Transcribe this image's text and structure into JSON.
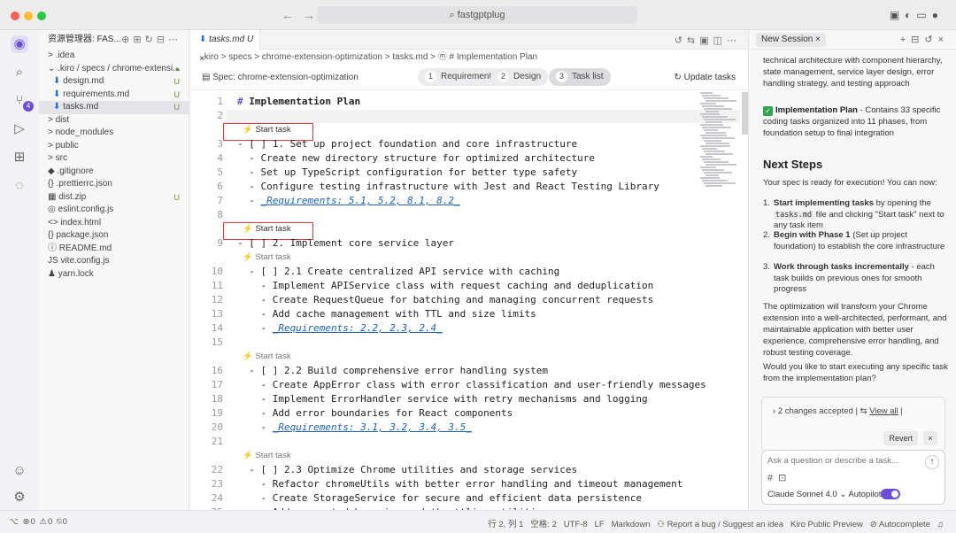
{
  "window": {
    "title": "fastgptplug"
  },
  "explorer": {
    "title": "资源管理器: FAS...",
    "items": [
      {
        "label": "> .idea",
        "indent": 0
      },
      {
        "label": "⌄ .kiro / specs / chrome-extensi...",
        "indent": 0,
        "status": "●"
      },
      {
        "label": "design.md",
        "indent": 1,
        "status": "U",
        "md": true
      },
      {
        "label": "requirements.md",
        "indent": 1,
        "status": "U",
        "md": true
      },
      {
        "label": "tasks.md",
        "indent": 1,
        "status": "U",
        "md": true,
        "selected": true
      },
      {
        "label": "> dist",
        "indent": 0
      },
      {
        "label": "> node_modules",
        "indent": 0
      },
      {
        "label": "> public",
        "indent": 0
      },
      {
        "label": "> src",
        "indent": 0
      },
      {
        "label": "◆ .gitignore",
        "indent": 0
      },
      {
        "label": "{} .prettierrc.json",
        "indent": 0
      },
      {
        "label": "▦ dist.zip",
        "indent": 0,
        "status": "U"
      },
      {
        "label": "◎ eslint.config.js",
        "indent": 0
      },
      {
        "label": "<> index.html",
        "indent": 0
      },
      {
        "label": "{} package.json",
        "indent": 0
      },
      {
        "label": "ⓘ README.md",
        "indent": 0
      },
      {
        "label": "JS vite.config.js",
        "indent": 0
      },
      {
        "label": "♟ yarn.lock",
        "indent": 0
      }
    ]
  },
  "editor": {
    "tab": "tasks.md U",
    "breadcrumb": ".kiro > specs > chrome-extension-optimization > tasks.md > ⓜ # Implementation Plan",
    "spec_label": "Spec: chrome-extension-optimization",
    "spec_tabs": [
      {
        "n": "1",
        "label": "Requirements"
      },
      {
        "n": "2",
        "label": "Design"
      },
      {
        "n": "3",
        "label": "Task list",
        "active": true
      }
    ],
    "update_label": "Update tasks",
    "codelens_label": "Start task",
    "lines": [
      {
        "n": "1",
        "text": "# Implementation Plan",
        "kind": "h1"
      },
      {
        "n": "2",
        "text": "",
        "current": true
      },
      {
        "n": "3",
        "text": "- [ ] 1. Set up project foundation and core infrastructure",
        "lens": "boxed"
      },
      {
        "n": "4",
        "text": "  - Create new directory structure for optimized architecture"
      },
      {
        "n": "5",
        "text": "  - Set up TypeScript configuration for better type safety"
      },
      {
        "n": "6",
        "text": "  - Configure testing infrastructure with Jest and React Testing Library"
      },
      {
        "n": "7",
        "text": "  - _Requirements: 5.1, 5.2, 8.1, 8.2_",
        "kind": "req"
      },
      {
        "n": "8",
        "text": ""
      },
      {
        "n": "9",
        "text": "- [ ] 2. Implement core service layer",
        "lens": "boxed"
      },
      {
        "n": "10",
        "text": "  - [ ] 2.1 Create centralized API service with caching",
        "lens": "plain"
      },
      {
        "n": "11",
        "text": "    - Implement APIService class with request caching and deduplication"
      },
      {
        "n": "12",
        "text": "    - Create RequestQueue for batching and managing concurrent requests"
      },
      {
        "n": "13",
        "text": "    - Add cache management with TTL and size limits"
      },
      {
        "n": "14",
        "text": "    - _Requirements: 2.2, 2.3, 2.4_",
        "kind": "req"
      },
      {
        "n": "15",
        "text": ""
      },
      {
        "n": "16",
        "text": "  - [ ] 2.2 Build comprehensive error handling system",
        "lens": "plain"
      },
      {
        "n": "17",
        "text": "    - Create AppError class with error classification and user-friendly messages"
      },
      {
        "n": "18",
        "text": "    - Implement ErrorHandler service with retry mechanisms and logging"
      },
      {
        "n": "19",
        "text": "    - Add error boundaries for React components"
      },
      {
        "n": "20",
        "text": "    - _Requirements: 3.1, 3.2, 3.4, 3.5_",
        "kind": "req"
      },
      {
        "n": "21",
        "text": ""
      },
      {
        "n": "22",
        "text": "  - [ ] 2.3 Optimize Chrome utilities and storage services",
        "lens": "plain"
      },
      {
        "n": "23",
        "text": "    - Refactor chromeUtils with better error handling and timeout management"
      },
      {
        "n": "24",
        "text": "    - Create StorageService for secure and efficient data persistence"
      },
      {
        "n": "25",
        "text": "    - Add request debouncing and throttling utilities"
      }
    ]
  },
  "chat": {
    "tab": "New Session ×",
    "top_text": "technical architecture with component hierarchy, state management, service layer design, error handling strategy, and testing approach",
    "plan_title": "Implementation Plan",
    "plan_text": " - Contains 33 specific coding tasks organized into 11 phases, from foundation setup to final integration",
    "next_steps": "Next Steps",
    "intro": "Your spec is ready for execution! You can now:",
    "steps": [
      {
        "n": "1.",
        "bold": "Start implementing tasks",
        "pre": " by opening the ",
        "code": "tasks.md",
        "post": " file and clicking \"Start task\" next to any task item"
      },
      {
        "n": "2.",
        "bold": "Begin with Phase 1",
        "pre": " (Set up project foundation) to establish the core infrastructure",
        "code": "",
        "post": ""
      },
      {
        "n": "3.",
        "bold": "Work through tasks incrementally",
        "pre": " - each task builds on previous ones for smooth progress",
        "code": "",
        "post": ""
      }
    ],
    "para1": "The optimization will transform your Chrome extension into a well-architected, performant, and maintainable application with better user experience, comprehensive error handling, and robust testing coverage.",
    "para2": "Would you like to start executing any specific task from the implementation plan?",
    "changes": "2 changes accepted",
    "view_all": "View all",
    "revert": "Revert",
    "input_placeholder": "Ask a question or describe a task...",
    "model": "Claude Sonnet 4.0",
    "autopilot": "Autopilot"
  },
  "status": {
    "left": "⌥  ⊗0 ⚠0  ⍉0",
    "position": "行 2, 列 1",
    "spaces": "空格: 2",
    "encoding": "UTF-8",
    "eol": "LF",
    "lang": "Markdown",
    "report": "Report a bug / Suggest an idea",
    "preview": "Kiro Public Preview",
    "autocomplete": "Autocomplete"
  },
  "colors": {
    "accent": "#6b4fd8",
    "requirement": "#1c63b7",
    "highlight_box": "#e13a3a"
  }
}
